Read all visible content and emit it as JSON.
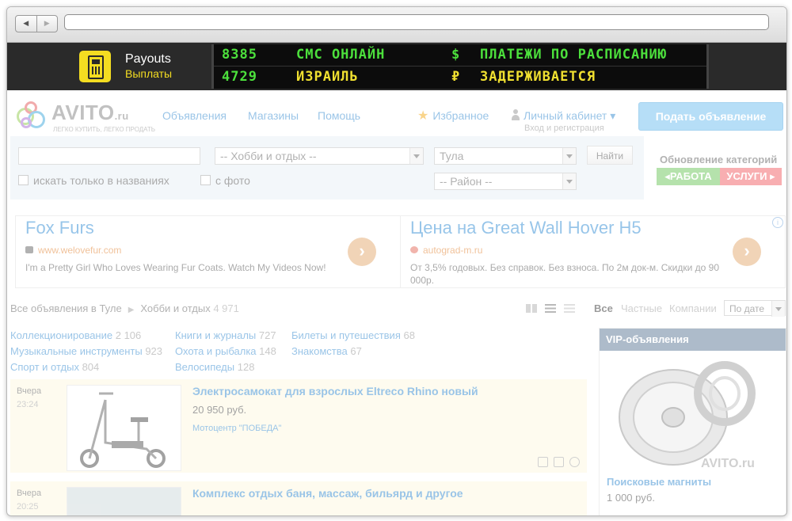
{
  "browser": {
    "url": ""
  },
  "banner": {
    "brand": "Payouts",
    "brand_ru": "Выплаты",
    "row1": {
      "num": "8385",
      "word": "СМС ОНЛАЙН",
      "sym": "$",
      "status": "ПЛАТЕЖИ ПО РАСПИСАНИЮ"
    },
    "row2": {
      "num": "4729",
      "word": "ИЗРАИЛЬ",
      "sym": "₽",
      "status": "ЗАДЕРЖИВАЕТСЯ"
    }
  },
  "header": {
    "logo": "AVITO",
    "logo_suffix": ".ru",
    "tagline": "ЛЕГКО КУПИТЬ, ЛЕГКО ПРОДАТЬ",
    "nav": [
      "Объявления",
      "Магазины",
      "Помощь"
    ],
    "favorites": "Избранное",
    "cabinet": "Личный кабинет ▾",
    "cabinet_sub": "Вход и регистрация",
    "post_button": "Подать объявление"
  },
  "search": {
    "query": "",
    "category": "-- Хобби и отдых --",
    "city": "Тула",
    "district": "-- Район --",
    "find": "Найти",
    "only_titles": "искать только в названиях",
    "with_photo": "с фото"
  },
  "updates": {
    "title": "Обновление категорий",
    "work": "РАБОТА",
    "services": "УСЛУГИ",
    "work_color": "#5cc14a",
    "services_color": "#f04d55"
  },
  "ads": [
    {
      "title": "Fox Furs",
      "url": "www.welovefur.com",
      "text": "I'm a Pretty Girl Who Loves Wearing Fur Coats. Watch My Videos Now!"
    },
    {
      "title": "Цена на Great Wall Hover H5",
      "url": "autograd-m.ru",
      "text": "От 3,5% годовых. Без справок. Без взноса. По 2м док-м. Скидки до 90 000р."
    }
  ],
  "breadcrumbs": {
    "root": "Все объявления в Туле",
    "current": "Хобби и отдых",
    "count": "4 971"
  },
  "filters": {
    "all": "Все",
    "private": "Частные",
    "companies": "Компании",
    "sort": "По дате"
  },
  "categories": [
    {
      "name": "Коллекционирование",
      "count": "2 106"
    },
    {
      "name": "Музыкальные инструменты",
      "count": "923"
    },
    {
      "name": "Спорт и отдых",
      "count": "804"
    },
    {
      "name": "Книги и журналы",
      "count": "727"
    },
    {
      "name": "Охота и рыбалка",
      "count": "148"
    },
    {
      "name": "Велосипеды",
      "count": "128"
    },
    {
      "name": "Билеты и путешествия",
      "count": "68"
    },
    {
      "name": "Знакомства",
      "count": "67"
    }
  ],
  "items": [
    {
      "date": "Вчера",
      "time": "23:24",
      "title": "Электросамокат для взрослых Eltreco Rhino новый",
      "price": "20 950 руб.",
      "seller": "Мотоцентр \"ПОБЕДА\""
    },
    {
      "date": "Вчера",
      "time": "20:25",
      "title": "Комплекс отдых баня, массаж, бильярд и другое"
    }
  ],
  "vip": {
    "header": "VIP-объявления",
    "title": "Поисковые магниты",
    "price": "1 000 руб.",
    "watermark": "AVITO.ru"
  }
}
